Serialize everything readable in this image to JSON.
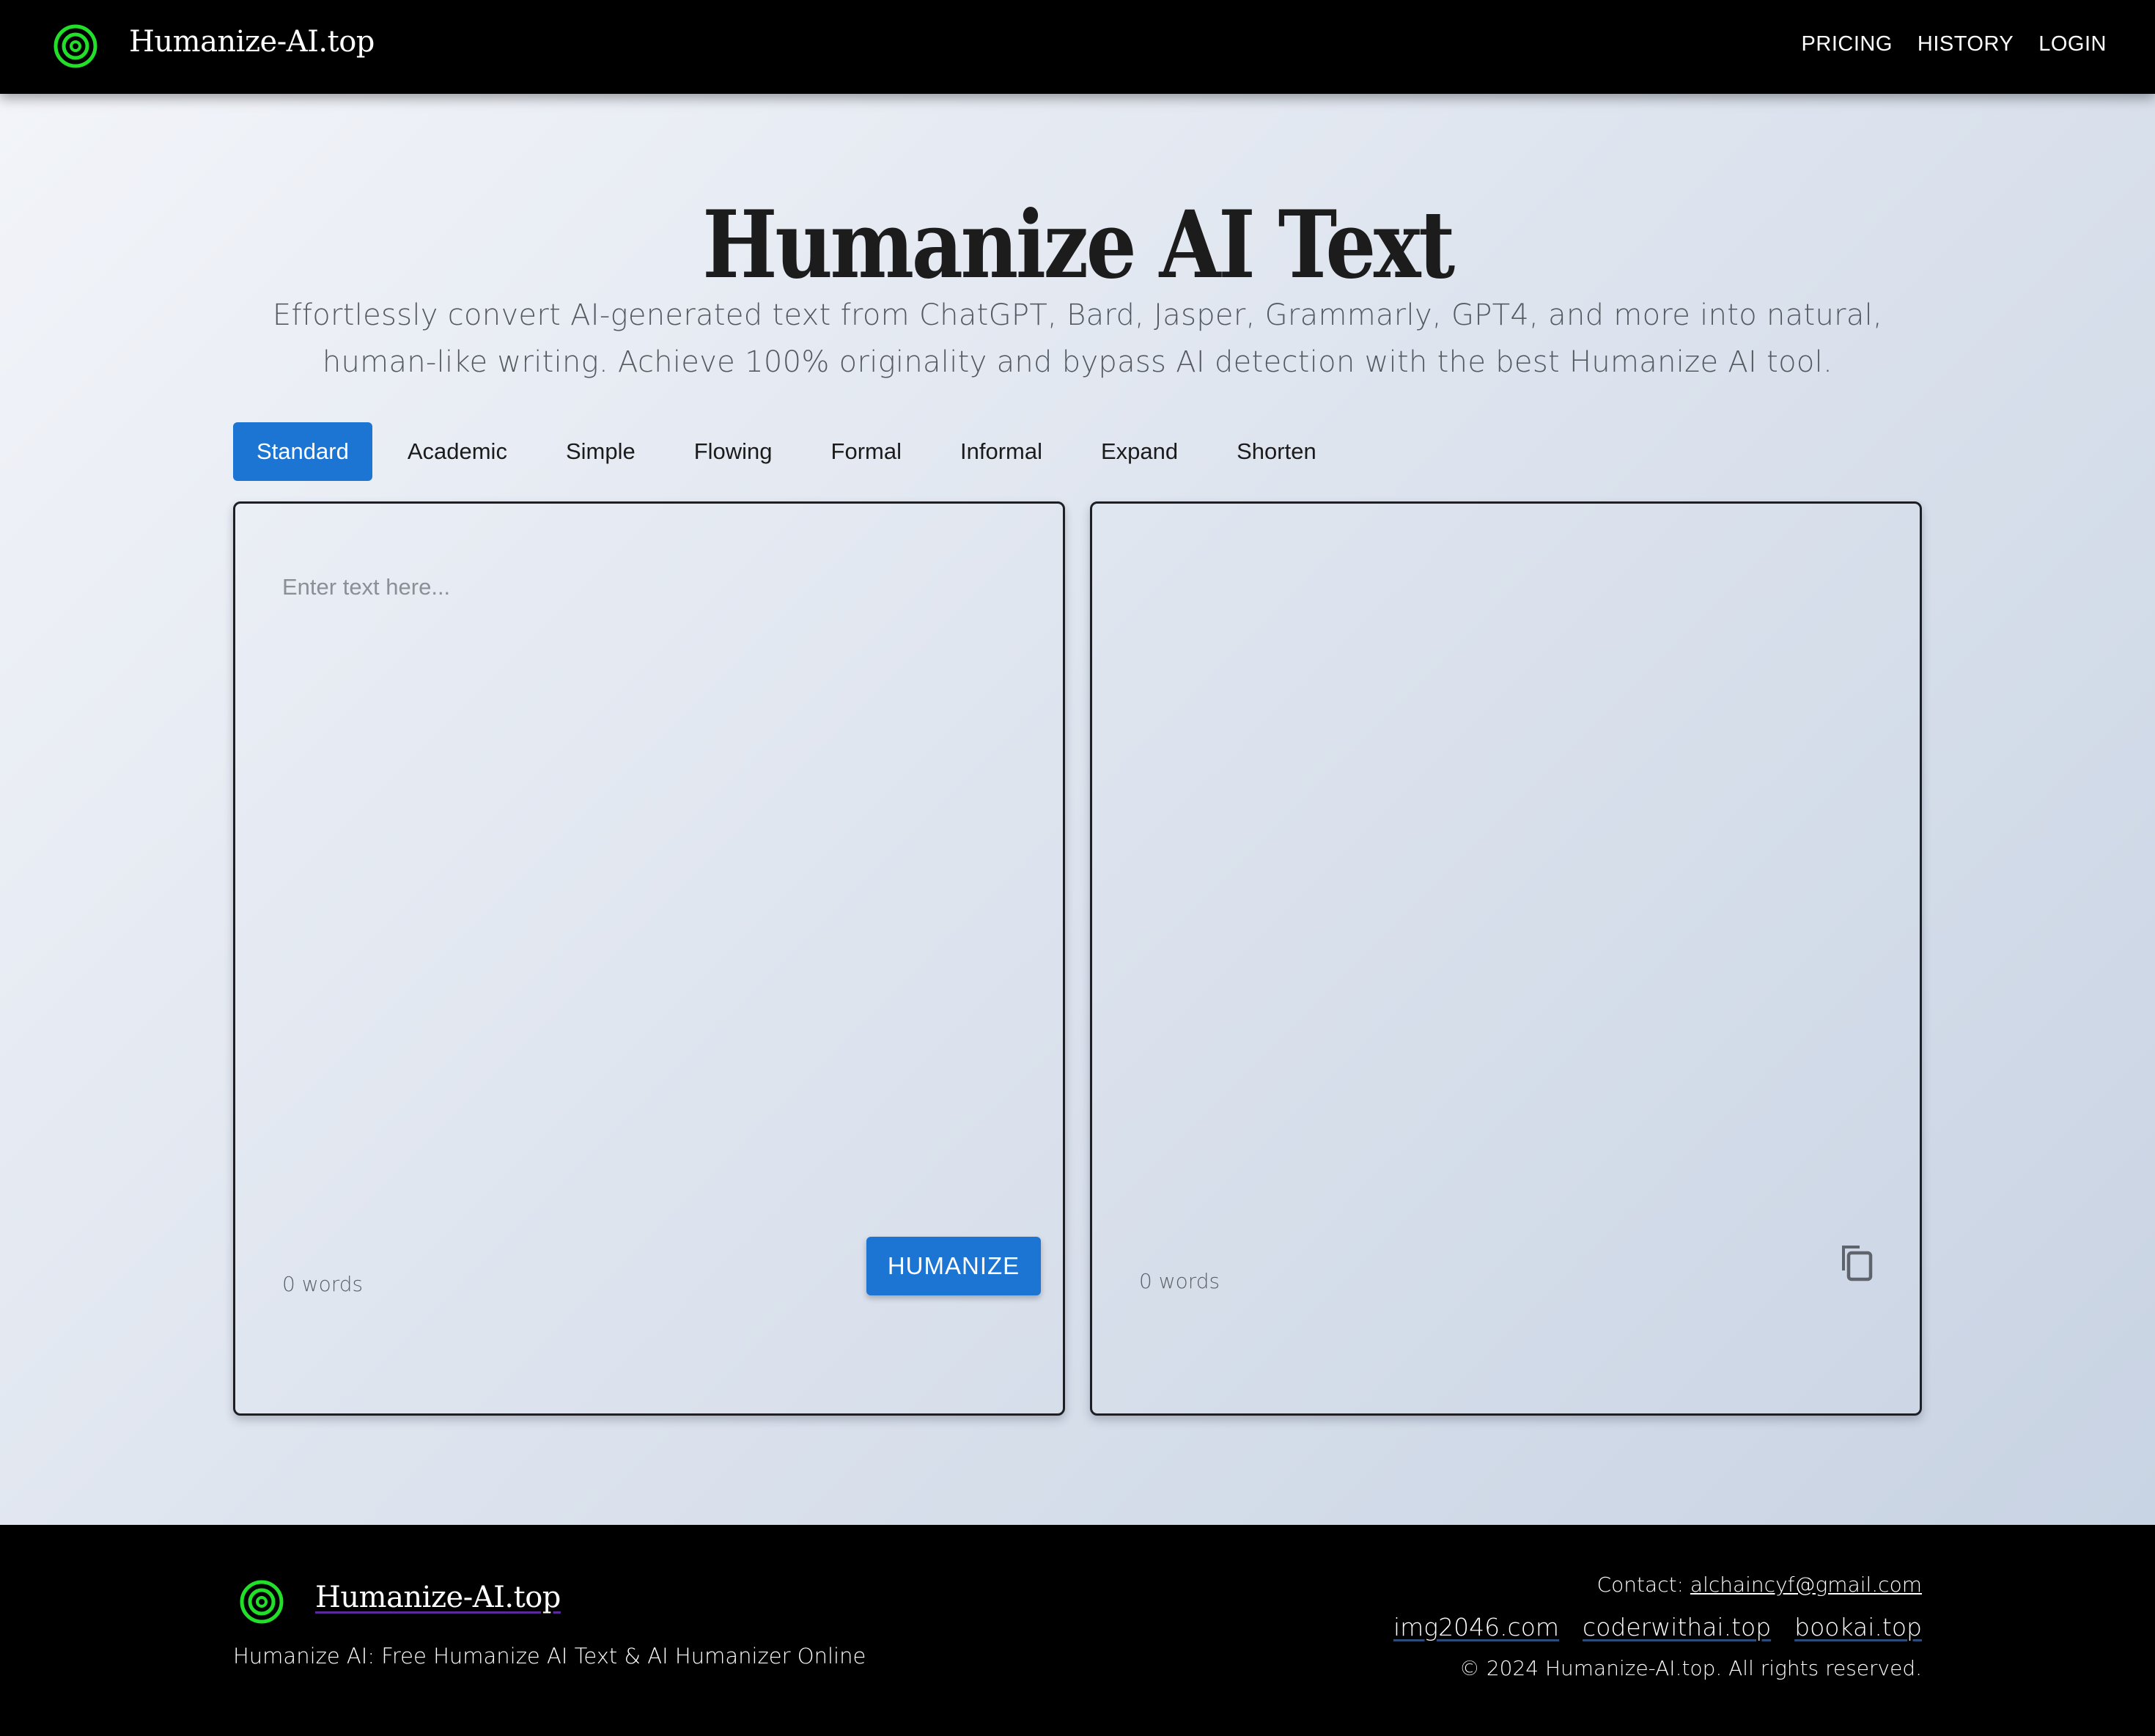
{
  "header": {
    "brand": "Humanize-AI.top",
    "logo_icon": "concentric-target-icon",
    "nav": [
      {
        "label": "PRICING"
      },
      {
        "label": "HISTORY"
      },
      {
        "label": "LOGIN"
      }
    ]
  },
  "hero": {
    "title": "Humanize AI Text",
    "subtitle": "Effortlessly convert AI-generated text from ChatGPT, Bard, Jasper, Grammarly, GPT4, and more into natural, human-like writing. Achieve 100% originality and bypass AI detection with the best Humanize AI tool."
  },
  "modes": {
    "selected": "Standard",
    "tabs": [
      {
        "label": "Standard"
      },
      {
        "label": "Academic"
      },
      {
        "label": "Simple"
      },
      {
        "label": "Flowing"
      },
      {
        "label": "Formal"
      },
      {
        "label": "Informal"
      },
      {
        "label": "Expand"
      },
      {
        "label": "Shorten"
      }
    ]
  },
  "editor": {
    "input": {
      "value": "",
      "placeholder": "Enter text here...",
      "word_count": "0 words",
      "submit_label": "HUMANIZE"
    },
    "output": {
      "value": "",
      "word_count": "0 words",
      "copy_icon": "copy-icon"
    }
  },
  "footer": {
    "brand": "Humanize-AI.top",
    "tagline": "Humanize AI: Free Humanize AI Text & AI Humanizer Online",
    "contact_label": "Contact:",
    "contact_email": "alchaincyf@gmail.com",
    "links": [
      {
        "label": "img2046.com"
      },
      {
        "label": "coderwithai.top"
      },
      {
        "label": "bookai.top"
      }
    ],
    "copyright": "© 2024 Humanize-AI.top. All rights reserved."
  },
  "colors": {
    "accent": "#1c75d2",
    "logo_green": "#22e02a",
    "header_bg": "#000000",
    "title_text": "#1c1c1c"
  }
}
